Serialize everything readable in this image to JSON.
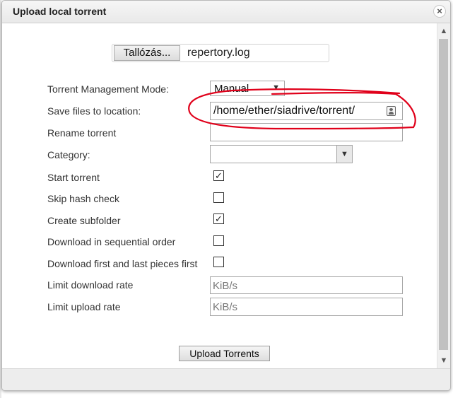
{
  "dialog": {
    "title": "Upload local torrent",
    "close_glyph": "×"
  },
  "file_picker": {
    "browse_label": "Tallózás...",
    "file_name": "repertory.log"
  },
  "form": {
    "management_mode_label": "Torrent Management Mode:",
    "management_mode_value": "Manual",
    "save_location_label": "Save files to location:",
    "save_location_value": "/home/ether/siadrive/torrent/",
    "rename_label": "Rename torrent",
    "rename_value": "",
    "category_label": "Category:",
    "category_value": "",
    "start_torrent_label": "Start torrent",
    "start_torrent_checked": true,
    "skip_hash_label": "Skip hash check",
    "skip_hash_checked": false,
    "create_subfolder_label": "Create subfolder",
    "create_subfolder_checked": true,
    "sequential_label": "Download in sequential order",
    "sequential_checked": false,
    "first_last_label": "Download first and last pieces first",
    "first_last_checked": false,
    "limit_download_label": "Limit download rate",
    "limit_download_placeholder": "KiB/s",
    "limit_upload_label": "Limit upload rate",
    "limit_upload_placeholder": "KiB/s"
  },
  "actions": {
    "upload_label": "Upload Torrents"
  },
  "glyphs": {
    "check": "✓",
    "dropdown_arrow": "▼",
    "scroll_up": "▲",
    "scroll_down": "▼"
  },
  "colors": {
    "annotation_stroke": "#e0001a"
  },
  "icons": {
    "contact": "contact-card-icon"
  }
}
